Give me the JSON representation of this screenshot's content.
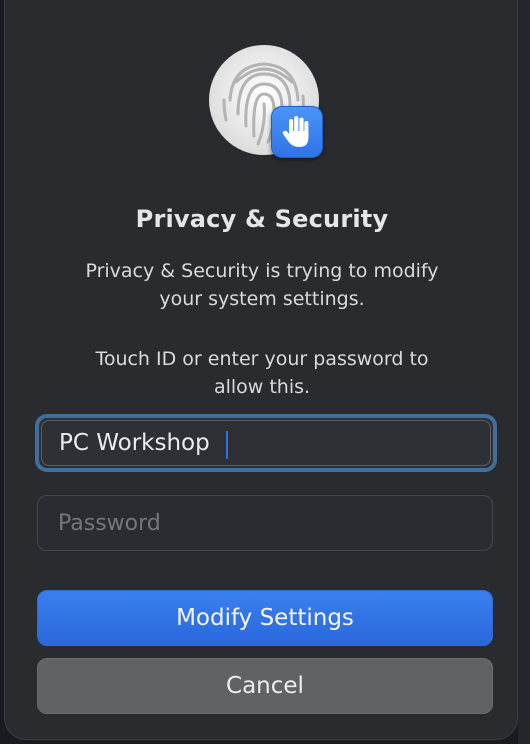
{
  "dialog": {
    "icons": {
      "main": "fingerprint-icon",
      "badge": "hand-raised-icon"
    },
    "title": "Privacy & Security",
    "message_line1": "Privacy & Security is trying to modify",
    "message_line2": "your system settings.",
    "prompt_line1": "Touch ID or enter your password to",
    "prompt_line2": "allow this.",
    "username": {
      "value": "PC Workshop"
    },
    "password": {
      "placeholder": "Password",
      "value": ""
    },
    "buttons": {
      "primary": "Modify Settings",
      "secondary": "Cancel"
    },
    "colors": {
      "accent": "#2f74e8",
      "focus_ring": "#3f6f9c",
      "background": "#2a2b2f"
    }
  }
}
